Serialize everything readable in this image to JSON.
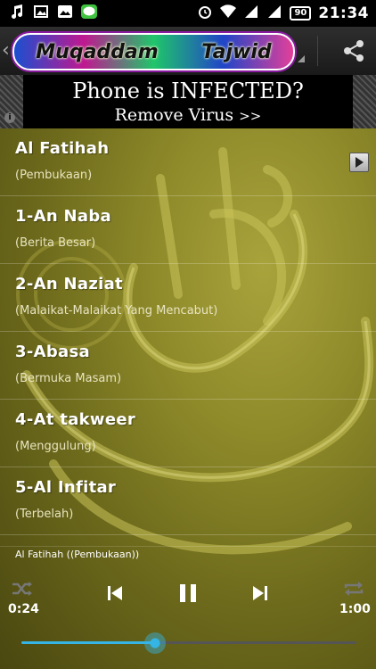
{
  "status_bar": {
    "time": "21:34",
    "battery": "90",
    "left_icons": [
      "music-note-icon",
      "gallery-icon",
      "photo-icon",
      "line-app-icon"
    ],
    "right_icons": [
      "alarm-icon",
      "wifi-icon",
      "signal-icon-1",
      "signal-icon-2"
    ]
  },
  "action_bar": {
    "logo_word1": "Muqaddam",
    "logo_word2": "Tajwid",
    "share_icon": "share-icon"
  },
  "ad": {
    "title": "Phone  is  INFECTED?",
    "subtitle": "Remove Virus",
    "arrows": ">>",
    "info": "i"
  },
  "list": {
    "items": [
      {
        "title": "Al Fatihah",
        "subtitle": "(Pembukaan)"
      },
      {
        "title": "1-An Naba",
        "subtitle": "(Berita Besar)"
      },
      {
        "title": "2-An Naziat",
        "subtitle": "(Malaikat-Malaikat Yang Mencabut)"
      },
      {
        "title": "3-Abasa",
        "subtitle": "(Bermuka Masam)"
      },
      {
        "title": "4-At takweer",
        "subtitle": "(Menggulung)"
      },
      {
        "title": "5-Al Infitar",
        "subtitle": "(Terbelah)"
      }
    ]
  },
  "player": {
    "now_playing": "Al Fatihah ((Pembukaan))",
    "elapsed": "0:24",
    "duration": "1:00",
    "progress": 0.4,
    "accent": "#35b5e5"
  }
}
